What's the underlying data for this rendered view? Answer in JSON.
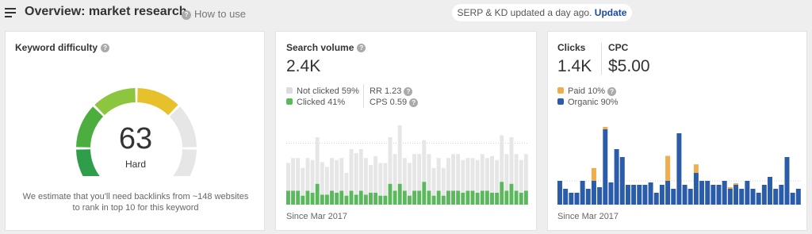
{
  "header": {
    "title": "Overview: market research",
    "help_icon": "?",
    "how_to_use": "How to use",
    "update_text": "SERP & KD updated a day ago.",
    "update_link": "Update"
  },
  "colors": {
    "green": "#5cb85c",
    "gray_bar": "#e6e6e6",
    "blue": "#2a5caa",
    "orange": "#f0ad4e",
    "gauge_dark_green": "#2e9e4a",
    "gauge_yellow": "#e6c12b",
    "gauge_gray": "#e6e6e6"
  },
  "keyword_difficulty": {
    "title": "Keyword difficulty",
    "value": "63",
    "level": 63,
    "label": "Hard",
    "note": "We estimate that you'll need backlinks from ~148 websites to rank in top 10 for this keyword"
  },
  "search_volume": {
    "title": "Search volume",
    "value": "2.4K",
    "not_clicked": "Not clicked 59%",
    "clicked": "Clicked 41%",
    "rr": "RR 1.23",
    "cps": "CPS 0.59",
    "since": "Since Mar 2017"
  },
  "clicks": {
    "title_clicks": "Clicks",
    "value_clicks": "1.4K",
    "title_cpc": "CPC",
    "value_cpc": "$5.00",
    "paid": "Paid 10%",
    "organic": "Organic 90%",
    "since": "Since Mar 2017"
  },
  "chart_data": [
    {
      "type": "bar",
      "name": "search-volume-history",
      "series": [
        {
          "name": "Not clicked",
          "values": [
            28,
            33,
            33,
            28,
            33,
            33,
            47,
            33,
            28,
            33,
            33,
            33,
            23,
            42,
            42,
            42,
            37,
            28,
            37,
            33,
            33,
            47,
            37,
            65,
            33,
            33,
            37,
            37,
            42,
            37,
            28,
            33,
            28,
            33,
            37,
            37,
            33,
            33,
            33,
            33,
            37,
            33,
            37,
            33,
            47,
            37,
            47,
            37,
            33,
            37
          ]
        },
        {
          "name": "Clicked",
          "values": [
            14,
            14,
            14,
            9,
            14,
            12,
            21,
            10,
            10,
            14,
            12,
            14,
            9,
            14,
            10,
            14,
            10,
            12,
            12,
            9,
            9,
            21,
            14,
            21,
            14,
            9,
            14,
            14,
            23,
            14,
            9,
            14,
            9,
            14,
            14,
            14,
            12,
            14,
            14,
            12,
            14,
            14,
            12,
            12,
            23,
            14,
            21,
            14,
            12,
            14
          ]
        }
      ]
    },
    {
      "type": "bar",
      "name": "clicks-history",
      "series": [
        {
          "name": "Organic",
          "values": [
            30,
            20,
            15,
            15,
            30,
            20,
            30,
            22,
            95,
            28,
            70,
            60,
            25,
            25,
            25,
            25,
            28,
            15,
            25,
            30,
            20,
            90,
            25,
            20,
            40,
            30,
            30,
            25,
            25,
            30,
            20,
            25,
            20,
            30,
            20,
            15,
            25,
            35,
            20,
            25,
            60,
            15,
            20
          ]
        },
        {
          "name": "Paid",
          "values": [
            0,
            0,
            0,
            0,
            0,
            0,
            0,
            0,
            3,
            0,
            0,
            0,
            0,
            0,
            0,
            0,
            0,
            0,
            0,
            0,
            0,
            0,
            0,
            0,
            0,
            0,
            0,
            0,
            0,
            0,
            2,
            2,
            0,
            0,
            0,
            0,
            0,
            0,
            0,
            0,
            0,
            0,
            0
          ]
        }
      ]
    }
  ]
}
